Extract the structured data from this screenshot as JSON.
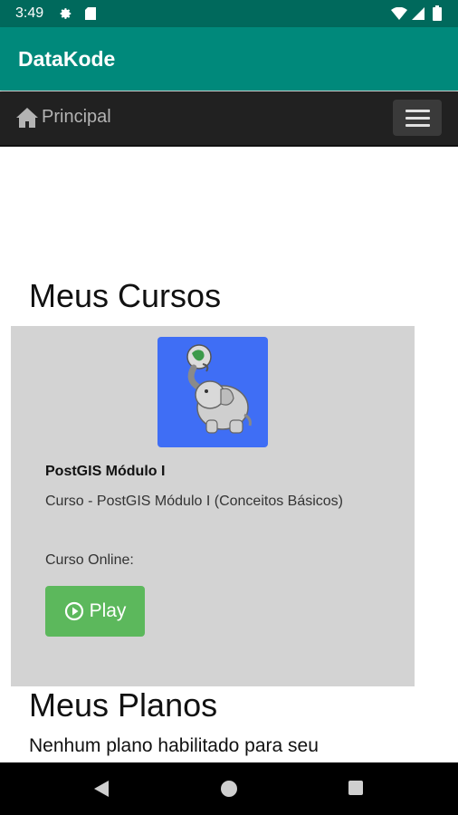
{
  "status_bar": {
    "time": "3:49"
  },
  "app_bar": {
    "title": "DataKode"
  },
  "navbar": {
    "home_label": "Principal"
  },
  "sections": {
    "cursos_title": "Meus Cursos",
    "planos_title": "Meus Planos",
    "planos_text": "Nenhum plano habilitado para seu"
  },
  "course": {
    "title": "PostGIS Módulo I",
    "description": "Curso - PostGIS Módulo I (Conceitos Básicos)",
    "type": "Curso Online:",
    "play_label": "Play"
  },
  "colors": {
    "status_bar": "#00695c",
    "app_bar": "#00897b",
    "navbar": "#212121",
    "card": "#d3d3d3",
    "play_button": "#5cb85c"
  }
}
